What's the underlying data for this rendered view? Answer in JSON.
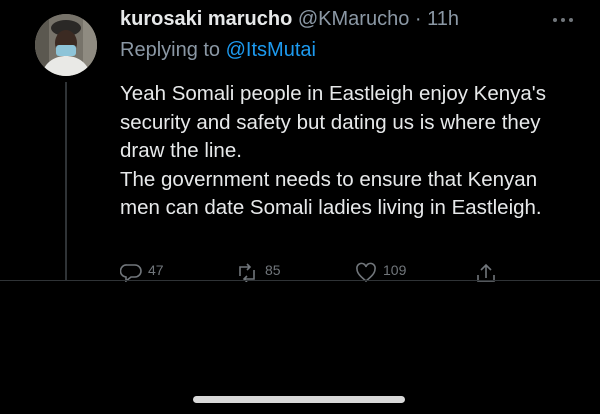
{
  "colors": {
    "background": "#000000",
    "primary_text": "#e7e9ea",
    "secondary_text": "#8b98a5",
    "accent": "#1d9bf0",
    "divider": "#2f3336"
  },
  "tweet": {
    "display_name": "kurosaki marucho",
    "handle": "@KMarucho",
    "separator": "·",
    "time_ago": "11h",
    "replying_prefix": "Replying to ",
    "replying_to": "@ItsMutai",
    "paragraphs": [
      "Yeah Somali people in Eastleigh enjoy Kenya's security and safety but dating us is where they draw the line.",
      "The government needs to ensure that Kenyan men can date Somali ladies living in Eastleigh."
    ],
    "actions": {
      "replies": "47",
      "retweets": "85",
      "likes": "109"
    },
    "icons": {
      "more": "more-dots-icon",
      "reply": "reply-icon",
      "retweet": "retweet-icon",
      "like": "heart-icon",
      "share": "share-icon"
    }
  }
}
